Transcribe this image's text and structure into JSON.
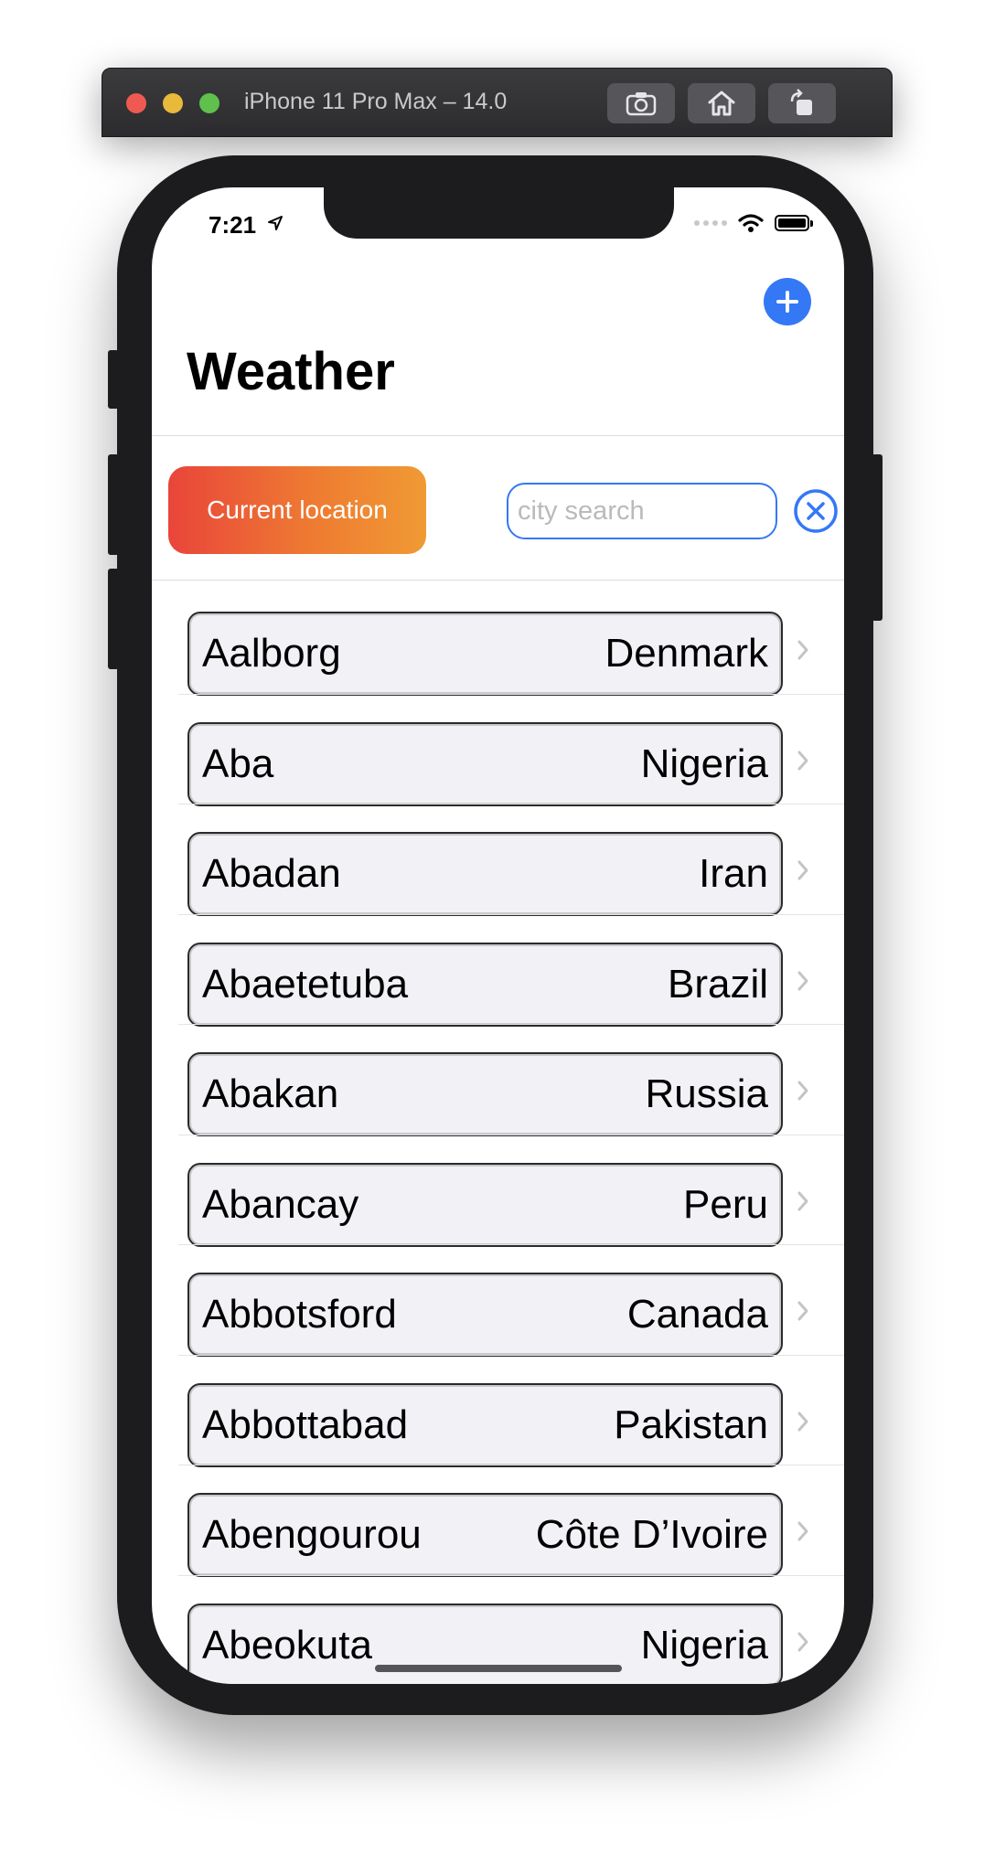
{
  "simulator": {
    "title": "iPhone 11 Pro Max – 14.0",
    "buttons": [
      "screenshot-icon",
      "home-icon",
      "rotate-icon"
    ]
  },
  "status_bar": {
    "time": "7:21"
  },
  "header": {
    "title": "Weather",
    "add_button_icon": "plus-icon"
  },
  "controls": {
    "location_button_label": "Current location",
    "search": {
      "placeholder": "city search",
      "value": ""
    },
    "clear_icon": "close-circle-icon"
  },
  "cities": [
    {
      "name": "Aalborg",
      "country": "Denmark"
    },
    {
      "name": "Aba",
      "country": "Nigeria"
    },
    {
      "name": "Abadan",
      "country": "Iran"
    },
    {
      "name": "Abaetetuba",
      "country": "Brazil"
    },
    {
      "name": "Abakan",
      "country": "Russia"
    },
    {
      "name": "Abancay",
      "country": "Peru"
    },
    {
      "name": "Abbotsford",
      "country": "Canada"
    },
    {
      "name": "Abbottabad",
      "country": "Pakistan"
    },
    {
      "name": "Abengourou",
      "country": "Côte D’Ivoire"
    },
    {
      "name": "Abeokuta",
      "country": "Nigeria"
    }
  ],
  "colors": {
    "accent": "#3478f6",
    "location_gradient_start": "#e9453a",
    "location_gradient_end": "#f09a34",
    "card_background": "#f1f1f6"
  }
}
